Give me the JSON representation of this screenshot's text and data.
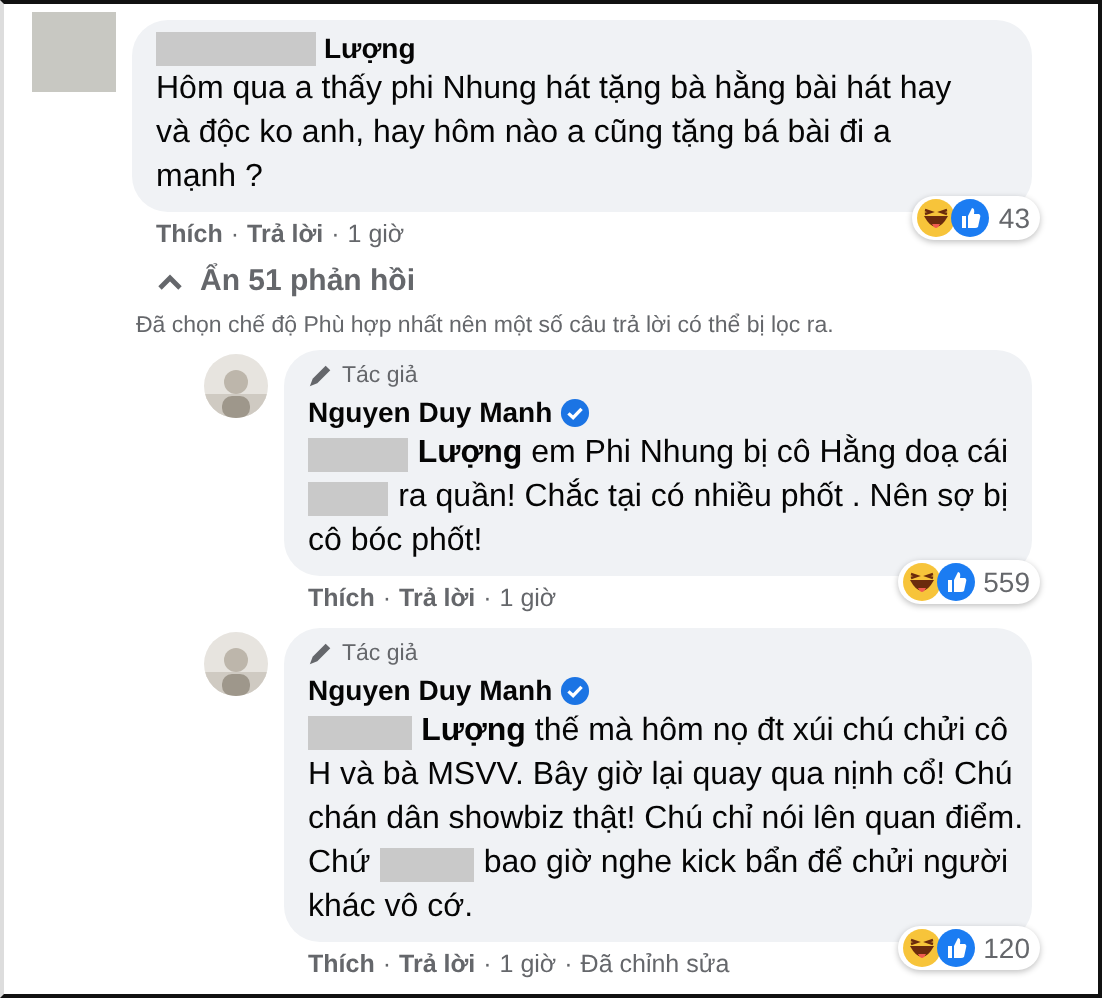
{
  "separator": "·",
  "comment": {
    "author": [
      {
        "kind": "redacted"
      },
      {
        "kind": "text",
        "text": "Lượng"
      }
    ],
    "lines": [
      [
        {
          "kind": "text",
          "text": "Hôm qua a thấy phi Nhung hát tặng bà hằng bài hát hay"
        }
      ],
      [
        {
          "kind": "text",
          "text": "và độc ko anh, hay hôm nào a cũng tặng bá bài đi a"
        }
      ],
      [
        {
          "kind": "text",
          "text": "mạnh ?"
        }
      ]
    ],
    "reaction_count": "43",
    "actions": [
      "Thích",
      "Trả lời"
    ],
    "meta": [
      "1 giờ"
    ]
  },
  "toggle": {
    "label": "Ẩn 51 phản hồi"
  },
  "filter_note": "Đã chọn chế độ Phù hợp nhất nên một số câu trả lời có thể bị lọc ra.",
  "replies": [
    {
      "badge": "Tác giả",
      "author": "Nguyen Duy Manh",
      "verified": true,
      "lines": [
        [
          {
            "kind": "redacted"
          },
          {
            "kind": "text",
            "text": "**Lượng** em Phi Nhung bị cô Hằng doạ cái"
          }
        ],
        [
          {
            "kind": "redacted"
          },
          {
            "kind": "text",
            "text": "ra quần! Chắc tại có nhiều phốt . Nên sợ bị"
          }
        ],
        [
          {
            "kind": "text",
            "text": "cô bóc phốt!"
          }
        ]
      ],
      "reaction_count": "559",
      "actions": [
        "Thích",
        "Trả lời"
      ],
      "meta": [
        "1 giờ"
      ]
    },
    {
      "badge": "Tác giả",
      "author": "Nguyen Duy Manh",
      "verified": true,
      "lines": [
        [
          {
            "kind": "redacted"
          },
          {
            "kind": "text",
            "text": "**Lượng** thế mà hôm nọ đt xúi chú chửi cô"
          }
        ],
        [
          {
            "kind": "text",
            "text": "H và bà MSVV. Bây giờ lại quay qua nịnh cổ! Chú"
          }
        ],
        [
          {
            "kind": "text",
            "text": "chán dân showbiz thật! Chú chỉ nói lên quan điểm."
          }
        ],
        [
          {
            "kind": "text",
            "text": "Chứ"
          },
          {
            "kind": "redacted"
          },
          {
            "kind": "text",
            "text": "bao giờ nghe kick bẩn để chửi người"
          }
        ],
        [
          {
            "kind": "text",
            "text": "khác vô cớ."
          }
        ]
      ],
      "reaction_count": "120",
      "actions": [
        "Thích",
        "Trả lời"
      ],
      "meta": [
        "1 giờ",
        "Đã chỉnh sửa"
      ]
    }
  ]
}
